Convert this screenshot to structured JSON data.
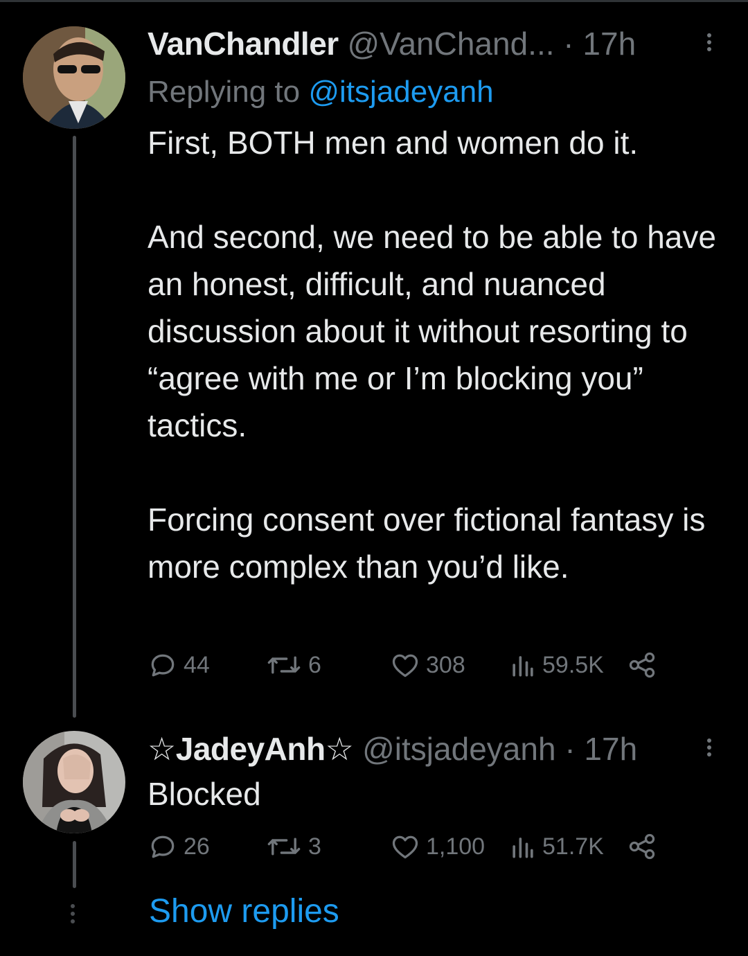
{
  "tweet1": {
    "display_name": "VanChandler",
    "handle": "@VanChand...",
    "separator": "·",
    "time": "17h",
    "replying_label": "Replying to",
    "replying_mention": "@itsjadeyanh",
    "paragraphs": [
      "First, BOTH men and women do it.",
      "And second, we need to be able to have an honest, difficult, and nuanced discussion about it without resorting to “agree with me or I’m blocking you” tactics.",
      "Forcing consent over fictional fantasy is more complex than you’d like."
    ],
    "replies": "44",
    "retweets": "6",
    "likes": "308",
    "views": "59.5K"
  },
  "tweet2": {
    "display_name": "☆JadeyAnh☆",
    "handle": "@itsjadeyanh",
    "separator": "·",
    "time": "17h",
    "text": "Blocked",
    "replies": "26",
    "retweets": "3",
    "likes": "1,100",
    "views": "51.7K"
  },
  "show_replies_label": "Show replies",
  "colors": {
    "background": "#000000",
    "text": "#e7e9ea",
    "muted": "#71767b",
    "accent": "#1d9bf0",
    "thread_line": "#4a4d51"
  },
  "icons": [
    "more-vertical-icon",
    "reply-icon",
    "retweet-icon",
    "like-icon",
    "views-icon",
    "share-icon"
  ]
}
